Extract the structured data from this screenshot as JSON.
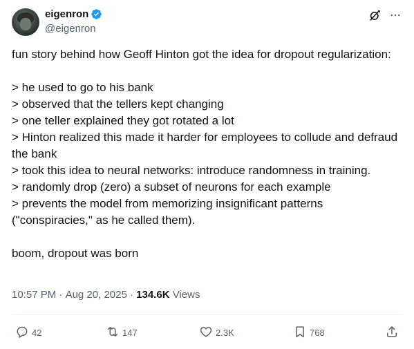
{
  "author": {
    "display_name": "eigenron",
    "handle": "@eigenron",
    "verified": true
  },
  "tweet": {
    "lines": [
      "fun story behind how Geoff Hinton got the idea for dropout regularization:",
      "",
      "> he used to go to his bank",
      "> observed that the tellers kept changing",
      "> one teller explained they got rotated a lot",
      "> Hinton realized this made it harder for employees to collude and defraud the bank",
      "> took this idea to neural networks: introduce randomness in training.",
      "> randomly drop (zero) a subset of neurons for each example",
      "> prevents the model from memorizing insignificant patterns (\"conspiracies,\" as he called them).",
      "",
      "boom, dropout was born"
    ]
  },
  "meta": {
    "time": "10:57 PM",
    "date": "Aug 20, 2025",
    "views_count": "134.6K",
    "views_label": "Views"
  },
  "actions": {
    "replies": "42",
    "retweets": "147",
    "likes": "2.3K",
    "bookmarks": "768"
  },
  "colors": {
    "text": "#0f1419",
    "secondary": "#536471",
    "verified": "#1d9bf0",
    "divider": "#eff3f4"
  },
  "icons": [
    "verified-badge-icon",
    "grok-icon",
    "more-icon",
    "reply-icon",
    "retweet-icon",
    "like-icon",
    "bookmark-icon",
    "share-icon"
  ]
}
